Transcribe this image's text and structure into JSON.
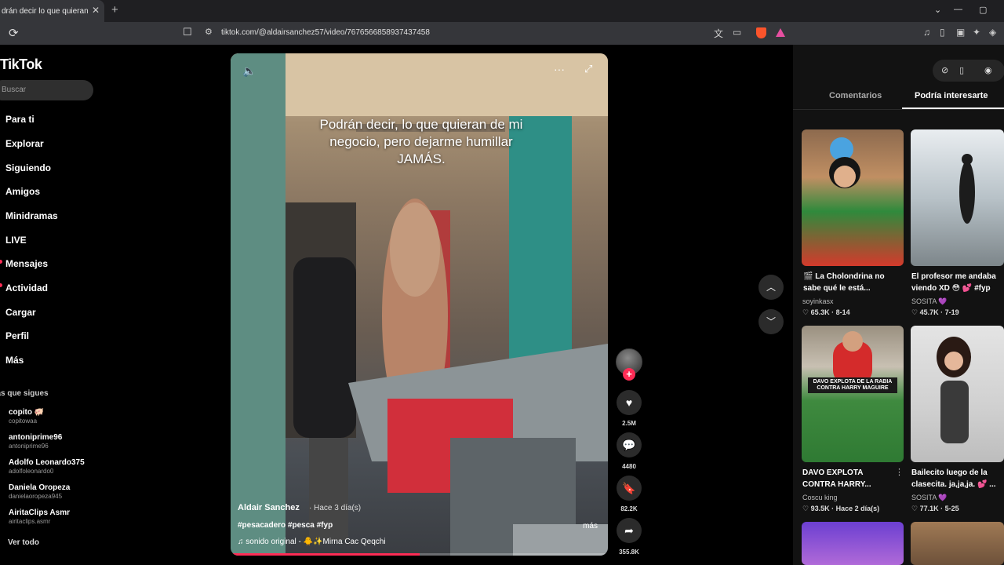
{
  "browser": {
    "tab_title": "drán decir lo que quieran de m",
    "tab_close": "✕",
    "new_tab": "+",
    "url": "tiktok.com/@aldairsanchez57/video/7676566858937437458",
    "win_controls": [
      "⌄",
      "—",
      "▢"
    ]
  },
  "sidebar": {
    "logo": "TikTok",
    "search_placeholder": "Buscar",
    "nav": [
      "Para ti",
      "Explorar",
      "Siguiendo",
      "Amigos",
      "Minidramas",
      "LIVE",
      "Mensajes",
      "Actividad",
      "Cargar",
      "Perfil",
      "Más"
    ],
    "following_title": "ntas que sigues",
    "accounts": [
      {
        "name": "copito 🐖",
        "handle": "copitowaa"
      },
      {
        "name": "antoniprime96",
        "handle": "antoniprime96"
      },
      {
        "name": "Adolfo Leonardo375",
        "handle": "adolfoleonardo0"
      },
      {
        "name": "Daniela Oropeza",
        "handle": "danielaoropeza945"
      },
      {
        "name": "AiritaClips Asmr",
        "handle": "airitaclips.asmr"
      }
    ],
    "see_all": "Ver todo"
  },
  "video": {
    "caption": "Podrán decir, lo que quieran de mi negocio, pero dejarme humillar JAMÁS.",
    "author": "Aldair Sanchez",
    "time": "· Hace 3 día(s)",
    "hashtags": "#pesacadero #pesca #fyp",
    "music": "♫  sonido original - 🐥✨Mirna Cac Qeqchi",
    "more": "más",
    "progress": 0.5
  },
  "actions": {
    "likes": "2.5M",
    "comments": "4480",
    "saves": "82.2K",
    "shares": "355.8K"
  },
  "panel": {
    "tab_comments": "Comentarios",
    "tab_recommended": "Podría interesarte",
    "cards": [
      {
        "title": "🎬 La Cholondrina no sabe qué le está...",
        "author": "soyinkasx",
        "stats": "♡ 65.3K · 8-14"
      },
      {
        "title": "El profesor me andaba viendo XD 😳 💕 #fyp",
        "author": "SOSITA 💜",
        "stats": "♡ 45.7K · 7-19"
      },
      {
        "title": "DAVO EXPLOTA CONTRA HARRY...",
        "author": "Coscu king",
        "stats": "♡ 93.5K · Hace 2 día(s)"
      },
      {
        "title": "Bailecito luego de la clasecita. ja,ja,ja. 💕 ...",
        "author": "SOSITA 💜",
        "stats": "♡ 77.1K · 5-25"
      }
    ],
    "thumb_text": "DAVO EXPLOTA DE LA RABIA CONTRA HARRY MAGUIRE"
  }
}
